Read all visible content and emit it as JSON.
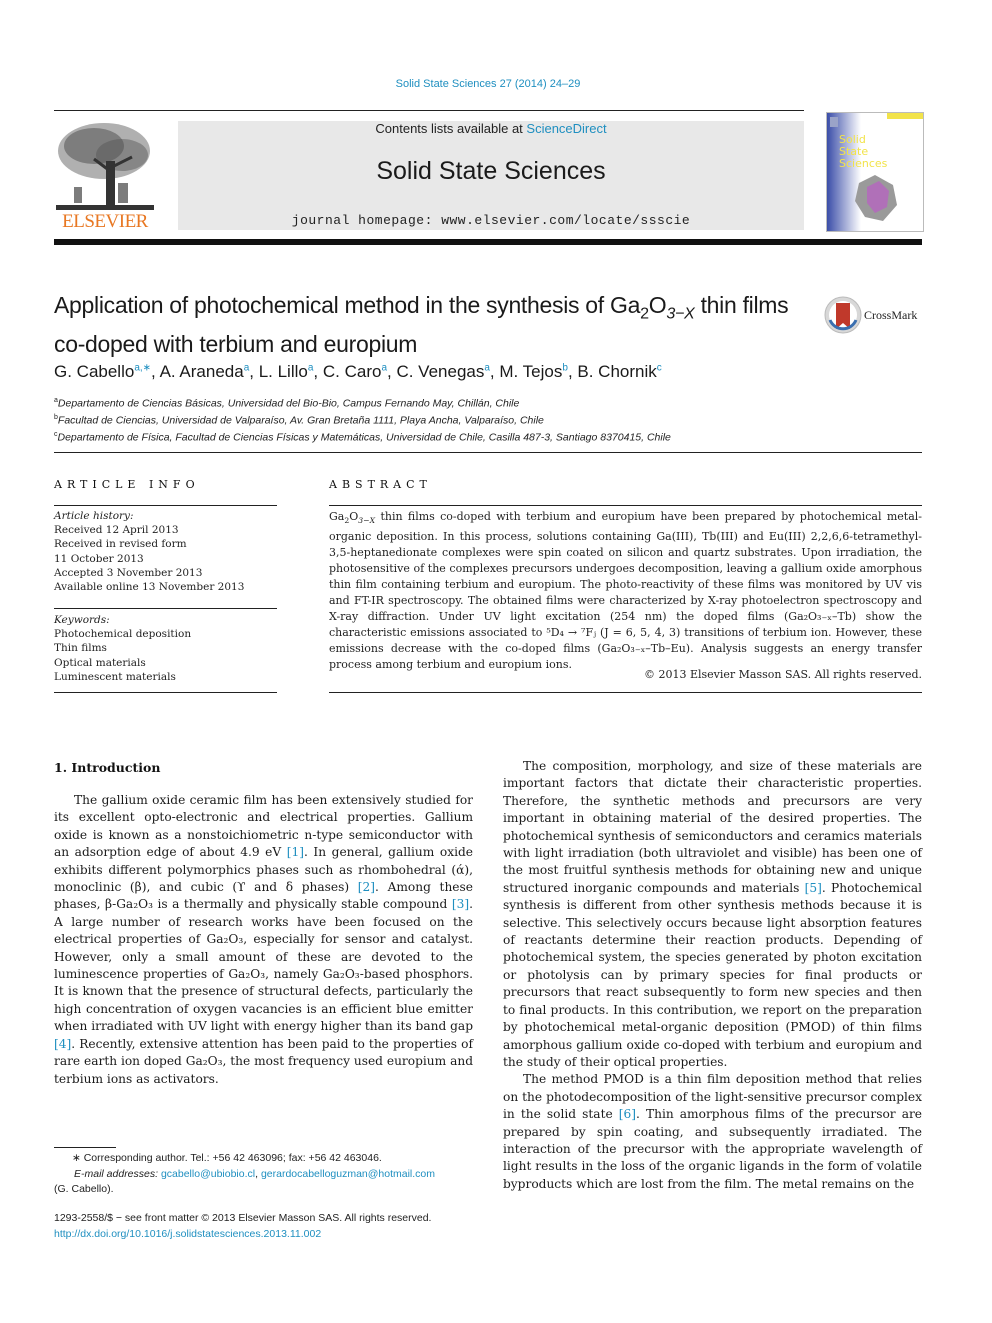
{
  "journal": {
    "citation": "Solid State Sciences 27 (2014) 24–29",
    "contents_prefix": "Contents lists available at ",
    "contents_link": "ScienceDirect",
    "title": "Solid State Sciences",
    "homepage": "journal homepage: www.elsevier.com/locate/ssscie",
    "publisher_logo": "ELSEVIER",
    "cover_title_lines": [
      "Solid",
      "State",
      "Sciences"
    ],
    "colors": {
      "link": "#1f8fc0",
      "elsevier_orange": "#e87722",
      "cover_blue": "#3a4da8",
      "cover_yellow": "#f2e34a"
    }
  },
  "article": {
    "title_part1": "Application of photochemical method in the synthesis of Ga",
    "title_sub1": "2",
    "title_part2": "O",
    "title_sub2": "3−X",
    "title_part3": " thin films co-doped with terbium and europium",
    "crossmark_label": "CrossMark",
    "authors": [
      {
        "name": "G. Cabello",
        "aff": "a,∗",
        "sep": ", "
      },
      {
        "name": "A. Araneda",
        "aff": "a",
        "sep": ", "
      },
      {
        "name": "L. Lillo",
        "aff": "a",
        "sep": ", "
      },
      {
        "name": "C. Caro",
        "aff": "a",
        "sep": ", "
      },
      {
        "name": "C. Venegas",
        "aff": "a",
        "sep": ", "
      },
      {
        "name": "M. Tejos",
        "aff": "b",
        "sep": ", "
      },
      {
        "name": "B. Chornik",
        "aff": "c",
        "sep": ""
      }
    ],
    "affiliations": [
      {
        "key": "a",
        "text": "Departamento de Ciencias Básicas, Universidad del Bio-Bio, Campus Fernando May, Chillán, Chile"
      },
      {
        "key": "b",
        "text": "Facultad de Ciencias, Universidad de Valparaíso, Av. Gran Bretaña 1111, Playa Ancha, Valparaíso, Chile"
      },
      {
        "key": "c",
        "text": "Departamento de Física, Facultad de Ciencias Físicas y Matemáticas, Universidad de Chile, Casilla 487-3, Santiago 8370415, Chile"
      }
    ]
  },
  "article_info": {
    "heading": "ARTICLE INFO",
    "history_label": "Article history:",
    "history": [
      "Received 12 April 2013",
      "Received in revised form",
      "11 October 2013",
      "Accepted 3 November 2013",
      "Available online 13 November 2013"
    ],
    "keywords_label": "Keywords:",
    "keywords": [
      "Photochemical deposition",
      "Thin films",
      "Optical materials",
      "Luminescent materials"
    ]
  },
  "abstract": {
    "heading": "ABSTRACT",
    "s1_pre": "Ga",
    "s1_sub1": "2",
    "s1_o": "O",
    "s1_sub2": "3−X",
    "s1_rest": " thin films co-doped with terbium and europium have been prepared by photochemical metal-organic deposition. In this process, solutions containing Ga(III), Tb(III) and Eu(III) 2,2,6,6-tetramethyl-3,5-heptanedionate complexes were spin coated on silicon and quartz substrates. Upon irradiation, the photosensitive of the complexes precursors undergoes decomposition, leaving a gallium oxide amorphous thin film containing terbium and europium. The photo-reactivity of these films was monitored by UV vis and FT-IR spectroscopy. The obtained films were characterized by X-ray photoelectron spectroscopy and X-ray diffraction. Under UV light excitation (254 nm) the doped films (Ga₂O₃₋ₓ–Tb) show the characteristic emissions associated to ⁵D₄ → ⁷Fⱼ (J = 6, 5, 4, 3) transitions of terbium ion. However, these emissions decrease with the co-doped films (Ga₂O₃₋ₓ–Tb–Eu). Analysis suggests an energy transfer process among terbium and europium ions.",
    "copyright": "© 2013 Elsevier Masson SAS. All rights reserved."
  },
  "introduction": {
    "heading": "1.  Introduction",
    "left_paragraph": [
      {
        "t": "The gallium oxide ceramic film has been extensively studied for its excellent opto-electronic and electrical properties. Gallium oxide is known as a nonstoichiometric n-type semiconductor with an adsorption edge of about 4.9 eV "
      },
      {
        "ref": "[1]"
      },
      {
        "t": ". In general, gallium oxide exhibits different polymorphics phases such as rhombohedral (ά), monoclinic (β), and cubic (ϒ and δ phases) "
      },
      {
        "ref": "[2]"
      },
      {
        "t": ". Among these phases, β-Ga₂O₃ is a thermally and physically stable compound "
      },
      {
        "ref": "[3]"
      },
      {
        "t": ". A large number of research works have been focused on the electrical properties of Ga₂O₃, especially for sensor and catalyst. However, only a small amount of these are devoted to the luminescence properties of Ga₂O₃, namely Ga₂O₃-based phosphors. It is known that the presence of structural defects, particularly the high concentration of oxygen vacancies is an efficient blue emitter when irradiated with UV light with energy higher than its band gap "
      },
      {
        "ref": "[4]"
      },
      {
        "t": ". Recently, extensive attention has been paid to the properties of rare earth ion doped Ga₂O₃, the most frequency used europium and terbium ions as activators."
      }
    ],
    "right_paragraph_1": [
      {
        "t": "The composition, morphology, and size of these materials are important factors that dictate their characteristic properties. Therefore, the synthetic methods and precursors are very important in obtaining material of the desired properties. The photochemical synthesis of semiconductors and ceramics materials with light irradiation (both ultraviolet and visible) has been one of the most fruitful synthesis methods for obtaining new and unique structured inorganic compounds and materials "
      },
      {
        "ref": "[5]"
      },
      {
        "t": ". Photochemical synthesis is different from other synthesis methods because it is selective. This selectively occurs because light absorption features of reactants determine their reaction products. Depending of photochemical system, the species generated by photon excitation or photolysis can by primary species for final products or precursors that react subsequently to form new species and then to final products. In this contribution, we report on the preparation by photochemical metal-organic deposition (PMOD) of thin films amorphous gallium oxide co-doped with terbium and europium and the study of their optical properties."
      }
    ],
    "right_paragraph_2": [
      {
        "t": "The method PMOD is a thin film deposition method that relies on the photodecomposition of the light-sensitive precursor complex in the solid state "
      },
      {
        "ref": "[6]"
      },
      {
        "t": ". Thin amorphous films of the precursor are prepared by spin coating, and subsequently irradiated. The interaction of the precursor with the appropriate wavelength of light results in the loss of the organic ligands in the form of volatile byproducts which are lost from the film. The metal remains on the"
      }
    ]
  },
  "footnotes": {
    "corresponding": "∗ Corresponding author. Tel.: +56 42 463096; fax: +56 42 463046.",
    "email_label": "E-mail addresses:",
    "email1": "gcabello@ubiobio.cl",
    "email_sep": ", ",
    "email2": "gerardocabelloguzman@hotmail.com",
    "email_owner": "(G. Cabello).",
    "issn": "1293-2558/$ − see front matter © 2013 Elsevier Masson SAS. All rights reserved.",
    "doi": "http://dx.doi.org/10.1016/j.solidstatesciences.2013.11.002"
  }
}
